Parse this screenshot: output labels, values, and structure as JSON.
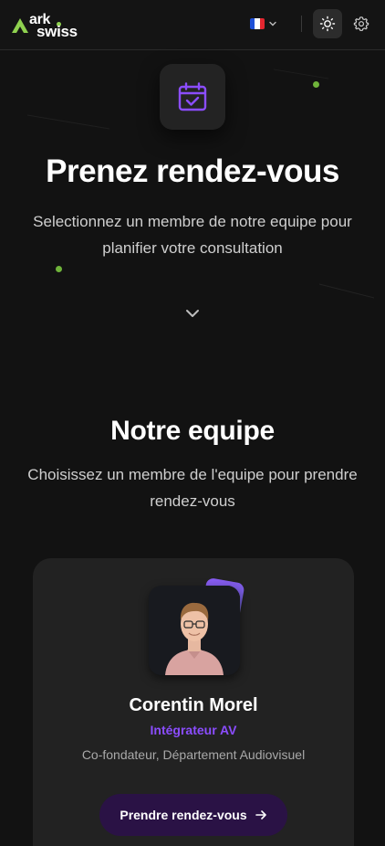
{
  "header": {
    "logo": {
      "line1": "ark",
      "line2": "swiss"
    },
    "language": {
      "flag_colors": [
        "#1f4fd6",
        "#ffffff",
        "#e3262f"
      ]
    },
    "icons": {
      "theme": "sun-icon",
      "settings": "gear-icon",
      "lang_chevron": "chevron-down-icon"
    }
  },
  "hero": {
    "icon": "calendar-check-icon",
    "title": "Prenez rendez-vous",
    "subtitle": "Selectionnez un membre de notre equipe pour planifier votre consultation",
    "scroll_icon": "chevron-down-icon"
  },
  "team": {
    "title": "Notre equipe",
    "subtitle": "Choisissez un membre de l'equipe pour prendre rendez-vous",
    "members": [
      {
        "name": "Corentin Morel",
        "role": "Intégrateur AV",
        "description": "Co-fondateur, Département Audiovisuel",
        "button_label": "Prendre rendez-vous"
      }
    ]
  },
  "colors": {
    "accent_green": "#8fd14f",
    "accent_purple": "#8b4dff",
    "button_bg": "#2a1245",
    "background": "#121212"
  }
}
